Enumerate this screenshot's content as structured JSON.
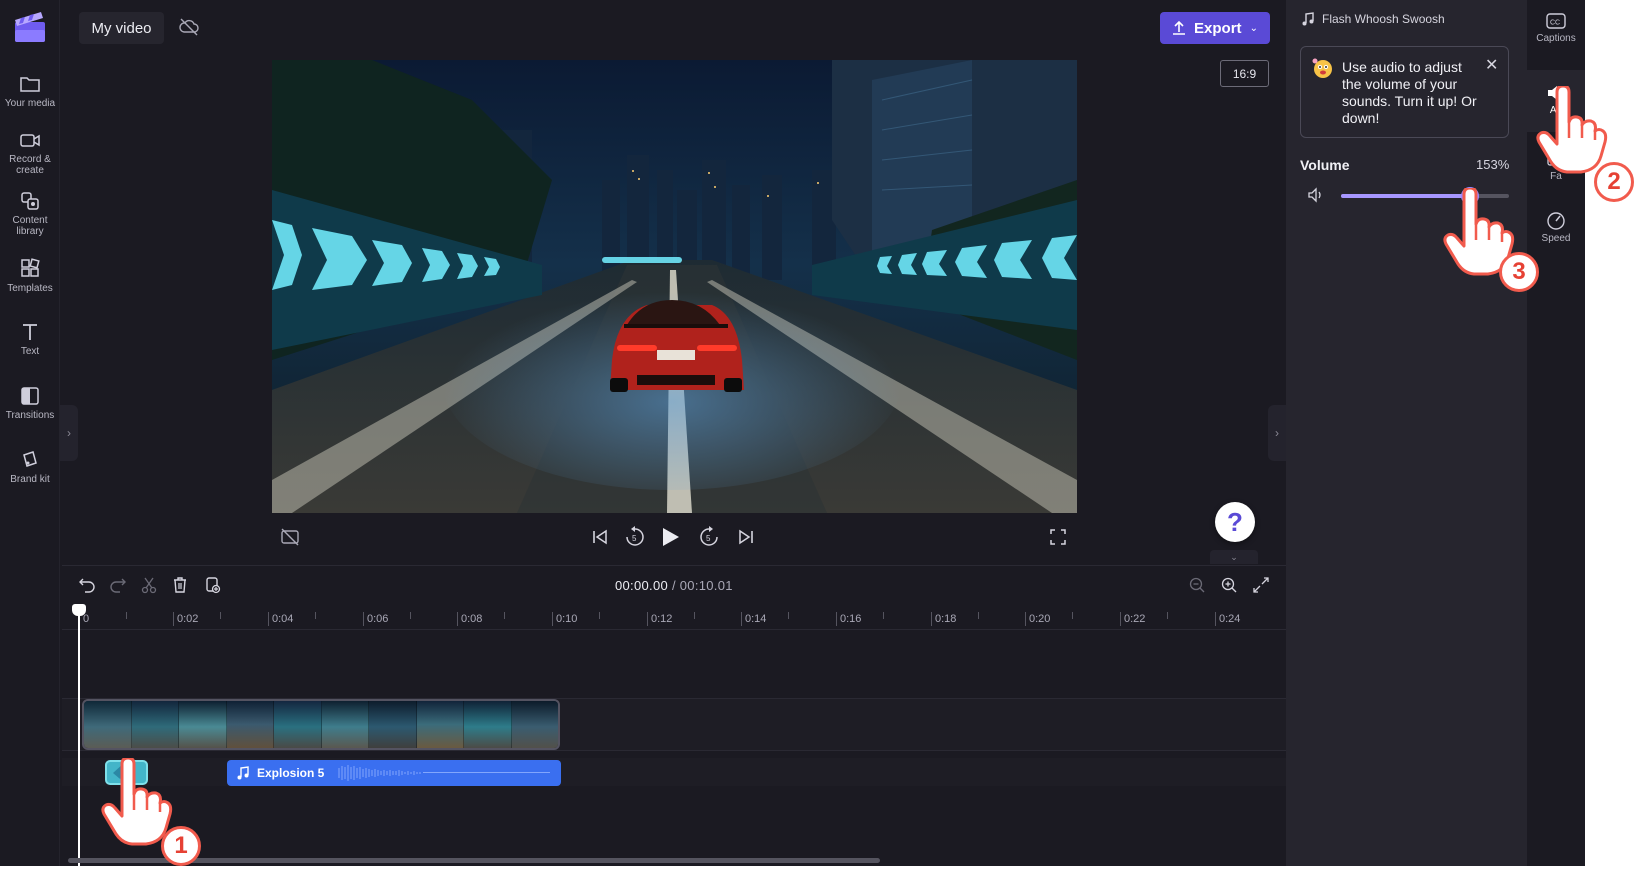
{
  "project": {
    "title": "My video"
  },
  "left_rail": {
    "items": [
      {
        "label": "Your media",
        "icon": "folder-icon"
      },
      {
        "label": "Record & create",
        "icon": "camera-icon"
      },
      {
        "label": "Content library",
        "icon": "content-library-icon"
      },
      {
        "label": "Templates",
        "icon": "templates-icon"
      },
      {
        "label": "Text",
        "icon": "text-icon"
      },
      {
        "label": "Transitions",
        "icon": "transitions-icon"
      },
      {
        "label": "Brand kit",
        "icon": "brand-kit-icon"
      }
    ]
  },
  "header": {
    "export_label": "Export",
    "aspect_ratio": "16:9"
  },
  "player": {
    "current_time": "00:00.00",
    "total_time": "/ 00:10.01",
    "help_label": "?"
  },
  "timeline": {
    "ruler_labels": [
      "0",
      "0:02",
      "0:04",
      "0:06",
      "0:08",
      "0:10",
      "0:12",
      "0:14",
      "0:16",
      "0:18",
      "0:20",
      "0:22",
      "0:24"
    ],
    "audio_clip_label": "Explosion 5"
  },
  "properties": {
    "asset_name": "Flash Whoosh Swoosh",
    "tip_text": "Use audio to adjust the volume of your sounds. Turn it up! Or down!",
    "volume_label": "Volume",
    "volume_value": "153%",
    "volume_fraction": 0.77
  },
  "tabs": [
    {
      "label": "Captions",
      "icon": "captions-icon"
    },
    {
      "label": "Au",
      "icon": "speaker-icon"
    },
    {
      "label": "Fa",
      "icon": "fade-icon"
    },
    {
      "label": "Speed",
      "icon": "speed-icon"
    }
  ],
  "tutorial": {
    "step_badges": [
      "1",
      "2",
      "3"
    ]
  },
  "colors": {
    "accent": "#5a4ad6",
    "slider": "#a797ff",
    "audio_clip": "#3a6ff0",
    "sfx_clip": "#43b5c9",
    "badge_ring": "#f15b4d"
  }
}
